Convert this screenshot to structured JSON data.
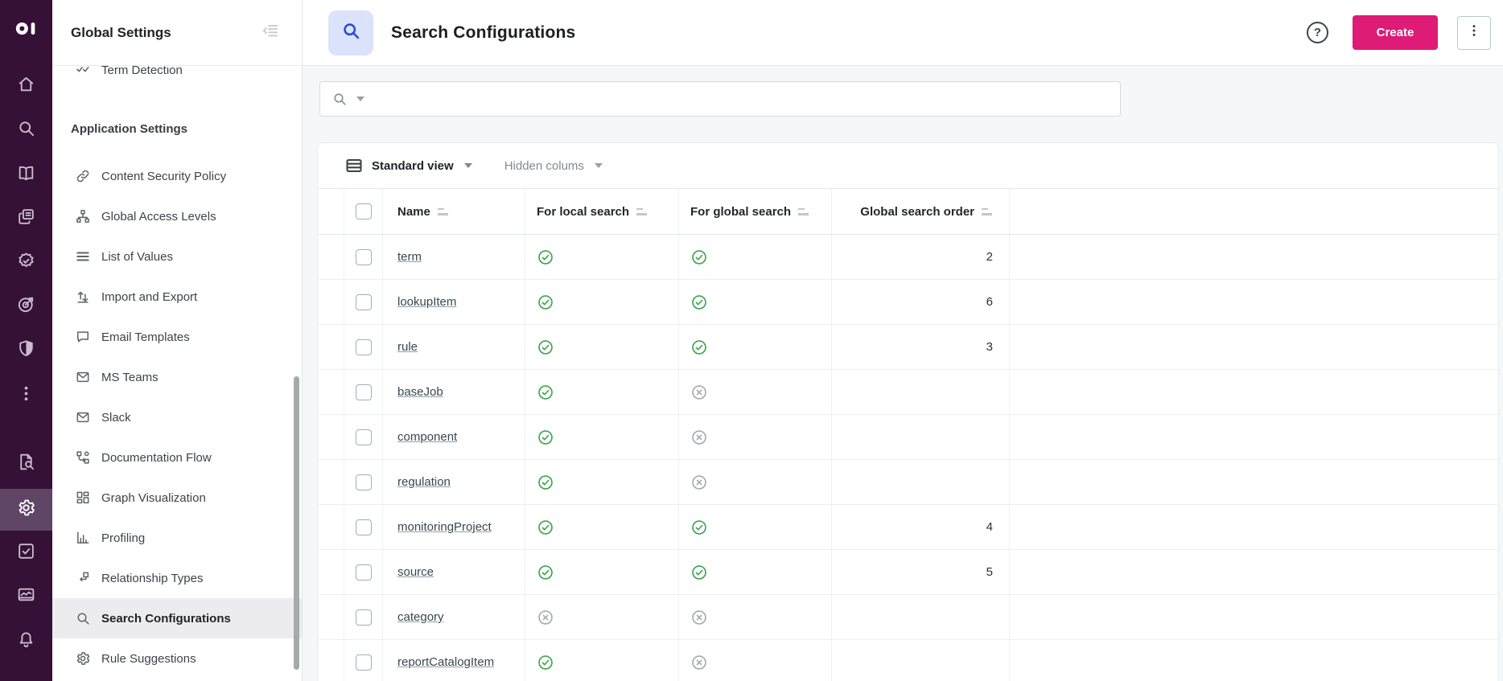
{
  "colors": {
    "accent_pink": "#de1b76",
    "status_green": "#3fa54c",
    "status_gray": "#a6abb0",
    "rail_purple": "#351037",
    "tile_blue_bg": "#dbe2fb",
    "tile_blue_icon": "#2a4bd7"
  },
  "rail": {
    "items": [
      {
        "icon": "home",
        "active": false
      },
      {
        "icon": "search",
        "active": false
      },
      {
        "icon": "book",
        "active": false
      },
      {
        "icon": "documents",
        "active": false
      },
      {
        "icon": "badge-check",
        "active": false
      },
      {
        "icon": "target",
        "active": false
      },
      {
        "icon": "shield-half",
        "active": false
      },
      {
        "icon": "more",
        "active": false
      },
      {
        "icon": "file-search",
        "active": false
      },
      {
        "icon": "settings",
        "active": true
      },
      {
        "icon": "task-check",
        "active": false
      },
      {
        "icon": "activity",
        "active": false
      },
      {
        "icon": "bell",
        "active": false
      }
    ]
  },
  "sidebar": {
    "title": "Global Settings",
    "partial_item": {
      "label": "Term Detection",
      "icon": "term-detection"
    },
    "section_header": "Application Settings",
    "items": [
      {
        "label": "Content Security Policy",
        "icon": "link",
        "selected": false
      },
      {
        "label": "Global Access Levels",
        "icon": "hierarchy",
        "selected": false
      },
      {
        "label": "List of Values",
        "icon": "list",
        "selected": false
      },
      {
        "label": "Import and Export",
        "icon": "import-export",
        "selected": false
      },
      {
        "label": "Email Templates",
        "icon": "chat",
        "selected": false
      },
      {
        "label": "MS Teams",
        "icon": "mail",
        "selected": false
      },
      {
        "label": "Slack",
        "icon": "mail",
        "selected": false
      },
      {
        "label": "Documentation Flow",
        "icon": "doc-flow",
        "selected": false
      },
      {
        "label": "Graph Visualization",
        "icon": "grid",
        "selected": false
      },
      {
        "label": "Profiling",
        "icon": "profiling",
        "selected": false
      },
      {
        "label": "Relationship Types",
        "icon": "relationship",
        "selected": false
      },
      {
        "label": "Search Configurations",
        "icon": "search",
        "selected": true
      },
      {
        "label": "Rule Suggestions",
        "icon": "settings",
        "selected": false
      }
    ]
  },
  "header": {
    "title": "Search Configurations",
    "help_label": "?",
    "create_label": "Create"
  },
  "toolbar": {
    "view_label": "Standard view",
    "hidden_columns_label": "Hidden colums"
  },
  "table": {
    "columns": [
      "Name",
      "For local search",
      "For global search",
      "Global search order"
    ],
    "rows": [
      {
        "name": "term",
        "local": true,
        "global": true,
        "order": "2"
      },
      {
        "name": "lookupItem",
        "local": true,
        "global": true,
        "order": "6"
      },
      {
        "name": "rule",
        "local": true,
        "global": true,
        "order": "3"
      },
      {
        "name": "baseJob",
        "local": true,
        "global": false,
        "order": ""
      },
      {
        "name": "component",
        "local": true,
        "global": false,
        "order": ""
      },
      {
        "name": "regulation",
        "local": true,
        "global": false,
        "order": ""
      },
      {
        "name": "monitoringProject",
        "local": true,
        "global": true,
        "order": "4"
      },
      {
        "name": "source",
        "local": true,
        "global": true,
        "order": "5"
      },
      {
        "name": "category",
        "local": false,
        "global": false,
        "order": ""
      },
      {
        "name": "reportCatalogItem",
        "local": true,
        "global": false,
        "order": ""
      }
    ]
  }
}
